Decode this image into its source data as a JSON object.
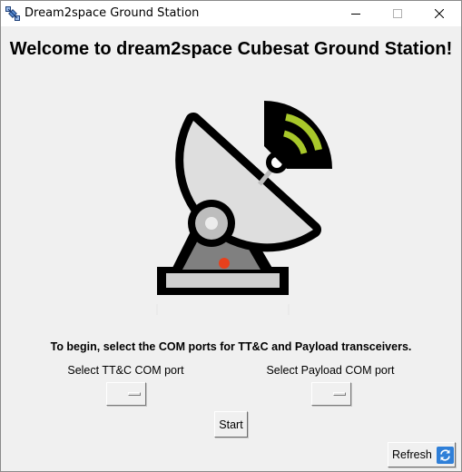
{
  "window": {
    "title": "Dream2space Ground Station",
    "controls": {
      "minimize": "minimize-icon",
      "maximize": "maximize-icon",
      "close": "close-icon"
    }
  },
  "main": {
    "heading": "Welcome to dream2space Cubesat Ground Station!",
    "hero_icon": "satellite-dish-icon",
    "instructions": "To begin, select the COM ports for TT&C and Payload transceivers.",
    "ttc_label": "Select TT&C COM port",
    "ttc_selected": "",
    "payload_label": "Select Payload COM port",
    "payload_selected": "",
    "start_label": "Start",
    "refresh_label": "Refresh",
    "refresh_icon": "refresh-icon"
  },
  "colors": {
    "signal_green": "#a8c82a",
    "indicator_red": "#e8401c",
    "refresh_blue": "#2f7fd8"
  }
}
